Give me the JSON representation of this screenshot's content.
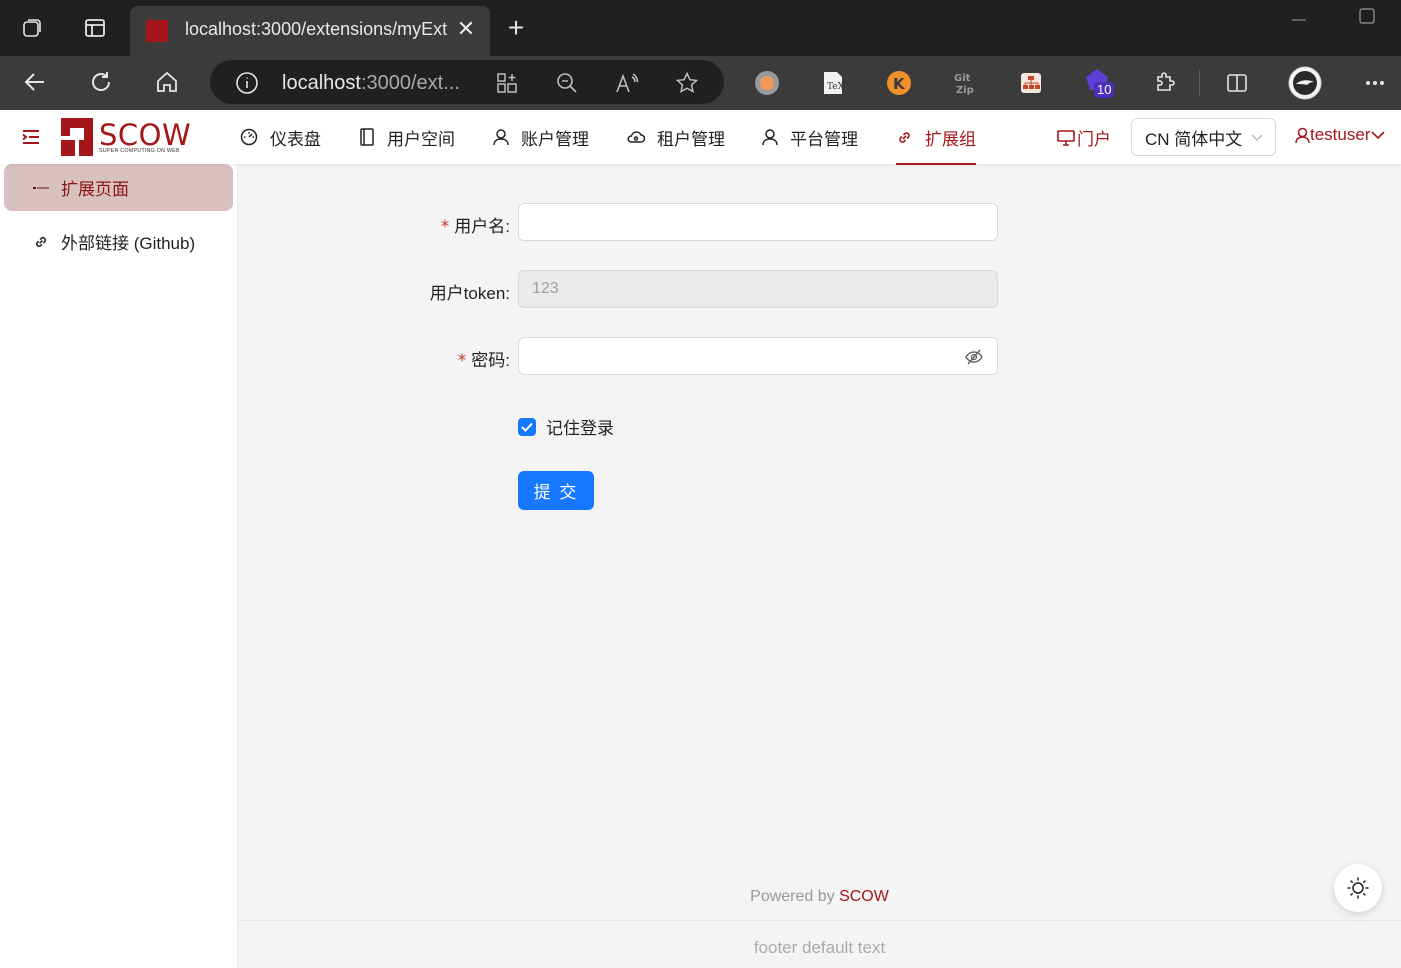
{
  "browser": {
    "tab_title": "localhost:3000/extensions/myExt",
    "url_host": "localhost",
    "url_rest": ":3000/ext...",
    "extension_badge": "10"
  },
  "header": {
    "logo_text": "SCOW",
    "logo_subtitle": "SUPER COMPUTING ON WEB",
    "nav": [
      {
        "label": "仪表盘",
        "icon": "dashboard-icon"
      },
      {
        "label": "用户空间",
        "icon": "book-icon"
      },
      {
        "label": "账户管理",
        "icon": "user-icon"
      },
      {
        "label": "租户管理",
        "icon": "cloud-icon"
      },
      {
        "label": "平台管理",
        "icon": "user-icon"
      },
      {
        "label": "扩展组",
        "icon": "link-icon"
      }
    ],
    "portal": "门户",
    "language": "CN 简体中文",
    "user": "testuser"
  },
  "sidebar": {
    "items": [
      {
        "label": "扩展页面"
      },
      {
        "label": "外部链接 (Github)"
      }
    ]
  },
  "form": {
    "username_label": "用户名:",
    "username_value": "",
    "token_label": "用户token:",
    "token_value": "123",
    "password_label": "密码:",
    "password_value": "",
    "remember_label": "记住登录",
    "remember_checked": true,
    "submit_label": "提 交"
  },
  "footer": {
    "powered_prefix": "Powered by ",
    "powered_brand": "SCOW",
    "text": "footer default text"
  },
  "colors": {
    "brand": "#a4161a",
    "primary": "#1677ff",
    "sidebar_active_bg": "#d8c1be"
  }
}
